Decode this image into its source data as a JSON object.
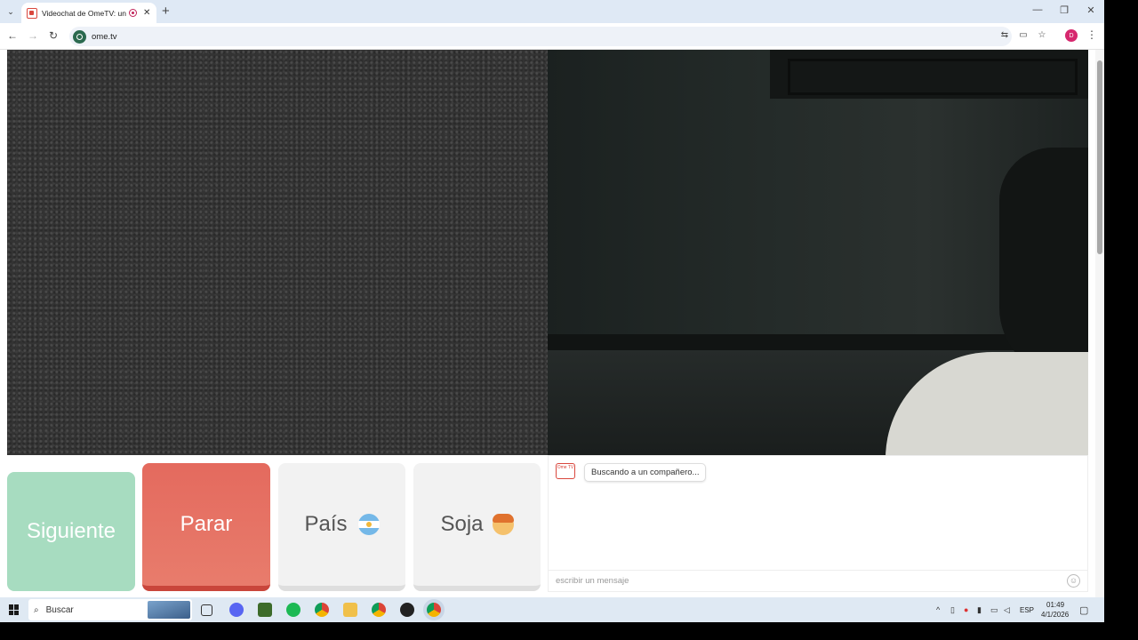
{
  "browser": {
    "tab_title": "Videochat de OmeTV: una",
    "url": "ome.tv",
    "profile_initial": "D"
  },
  "controls": {
    "next_label": "Siguiente",
    "stop_label": "Parar",
    "country_label": "País",
    "gender_label": "Soja"
  },
  "chat": {
    "logo_text": "Ome TV",
    "status_message": "Buscando a un compañero...",
    "input_placeholder": "escribir un mensaje"
  },
  "taskbar": {
    "search_placeholder": "Buscar",
    "language": "ESP",
    "time": "01:49",
    "date": "4/1/2026"
  },
  "colors": {
    "next_button": "#a7dcc0",
    "stop_button": "#e46a5e",
    "neutral_button": "#f2f2f2"
  }
}
